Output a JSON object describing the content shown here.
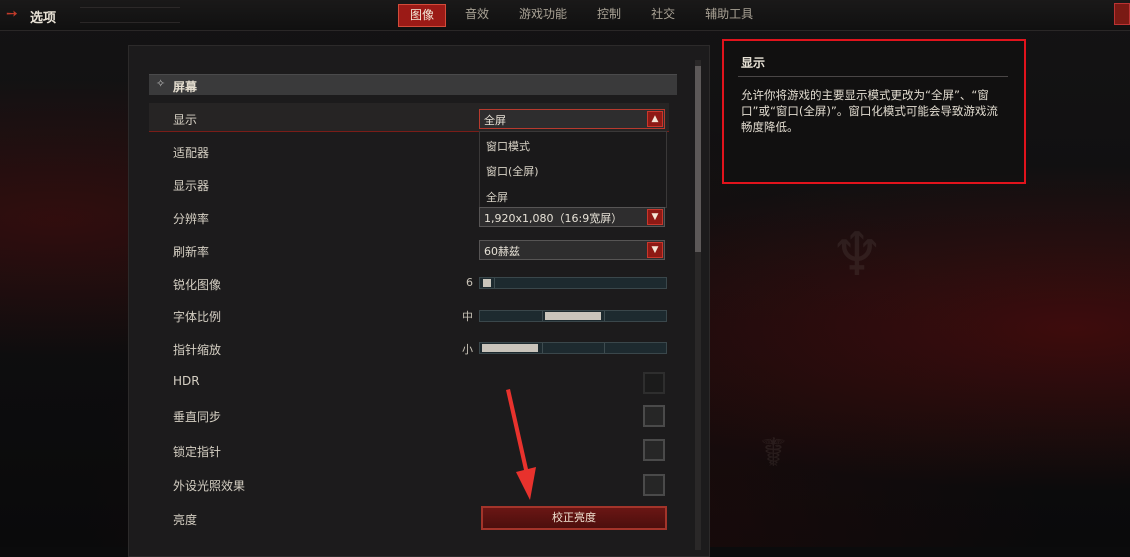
{
  "header": {
    "title": "选项",
    "tabs": [
      {
        "label": "图像",
        "active": true
      },
      {
        "label": "音效",
        "active": false
      },
      {
        "label": "游戏功能",
        "active": false
      },
      {
        "label": "控制",
        "active": false
      },
      {
        "label": "社交",
        "active": false
      },
      {
        "label": "辅助工具",
        "active": false
      }
    ]
  },
  "section": {
    "label": "屏幕"
  },
  "rows": {
    "display": {
      "label": "显示",
      "value": "全屏"
    },
    "adapter": {
      "label": "适配器"
    },
    "monitor": {
      "label": "显示器"
    },
    "resolution": {
      "label": "分辨率",
      "value": "1,920x1,080（16:9宽屏）"
    },
    "refresh": {
      "label": "刷新率",
      "value": "60赫兹"
    },
    "sharpen": {
      "label": "锐化图像",
      "value": "6",
      "level": 0.06
    },
    "font_scale": {
      "label": "字体比例",
      "value": "中"
    },
    "cursor_scale": {
      "label": "指针缩放",
      "value": "小"
    },
    "hdr": {
      "label": "HDR"
    },
    "vsync": {
      "label": "垂直同步"
    },
    "lock_cursor": {
      "label": "锁定指针"
    },
    "peripheral_lighting": {
      "label": "外设光照效果"
    },
    "brightness": {
      "label": "亮度",
      "button": "校正亮度"
    }
  },
  "display_menu": {
    "options": [
      "窗口模式",
      "窗口(全屏)",
      "全屏"
    ]
  },
  "info": {
    "title": "显示",
    "description": "允许你将游戏的主要显示模式更改为“全屏”、“窗口”或“窗口(全屏)”。窗口化模式可能会导致游戏流畅度降低。"
  },
  "colors": {
    "accent": "#9b1a16",
    "highlight_border": "#e1131c"
  },
  "icons": [
    "back-arrow-icon",
    "close-icon",
    "dropdown-arrow-icon",
    "section-diamond-icon"
  ]
}
